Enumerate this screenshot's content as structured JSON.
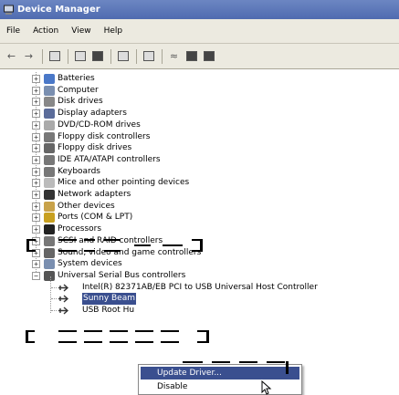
{
  "window": {
    "title": "Device Manager"
  },
  "menu": [
    "File",
    "Action",
    "View",
    "Help"
  ],
  "tree": {
    "categories": [
      {
        "label": "Batteries",
        "icon": "battery-icon"
      },
      {
        "label": "Computer",
        "icon": "computer-icon"
      },
      {
        "label": "Disk drives",
        "icon": "disk-drive-icon"
      },
      {
        "label": "Display adapters",
        "icon": "display-adapter-icon"
      },
      {
        "label": "DVD/CD-ROM drives",
        "icon": "dvd-drive-icon"
      },
      {
        "label": "Floppy disk controllers",
        "icon": "floppy-controller-icon"
      },
      {
        "label": "Floppy disk drives",
        "icon": "floppy-drive-icon"
      },
      {
        "label": "IDE ATA/ATAPI controllers",
        "icon": "ide-controller-icon"
      },
      {
        "label": "Keyboards",
        "icon": "keyboard-icon"
      },
      {
        "label": "Mice and other pointing devices",
        "icon": "mouse-icon"
      },
      {
        "label": "Network adapters",
        "icon": "network-adapter-icon"
      },
      {
        "label": "Other devices",
        "icon": "other-devices-icon"
      },
      {
        "label": "Ports (COM & LPT)",
        "icon": "port-icon"
      },
      {
        "label": "Processors",
        "icon": "processor-icon"
      },
      {
        "label": "SCSI and RAID controllers",
        "icon": "scsi-icon"
      },
      {
        "label": "Sound, video and game controllers",
        "icon": "sound-icon"
      },
      {
        "label": "System devices",
        "icon": "system-devices-icon"
      },
      {
        "label": "Universal Serial Bus controllers",
        "icon": "usb-icon"
      }
    ],
    "usb_children": [
      {
        "label": "Intel(R) 82371AB/EB PCI to USB Universal Host Controller",
        "icon": "usb-icon"
      },
      {
        "label": "Sunny Beam",
        "icon": "usb-icon"
      },
      {
        "label": "USB Root Hu",
        "icon": "usb-icon"
      }
    ]
  },
  "context_menu": {
    "items": [
      "Update Driver...",
      "Disable"
    ]
  },
  "colors": {
    "titlebar": "#5a74b8",
    "selection": "#3a4f8f"
  }
}
